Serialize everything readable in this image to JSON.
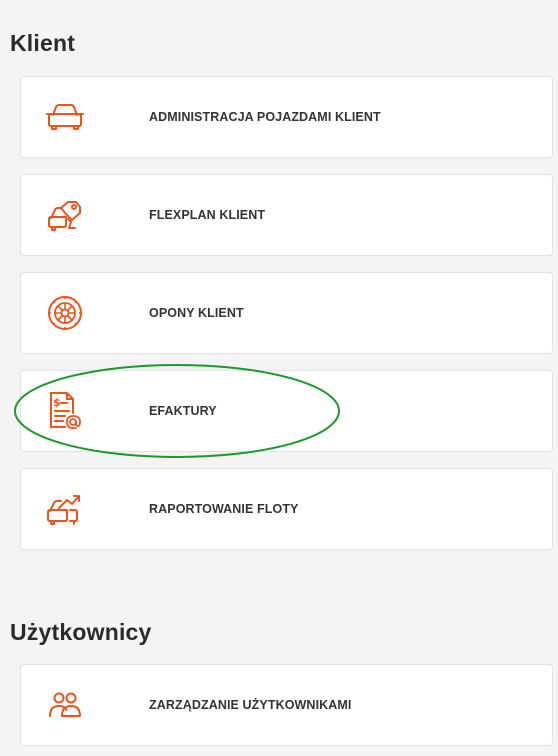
{
  "colors": {
    "accent": "#e8551f",
    "highlight": "#1a9a2a",
    "background": "#f4f4f4",
    "card": "#ffffff",
    "text": "#333333"
  },
  "sections": {
    "client": {
      "title": "Klient",
      "items": [
        {
          "label": "ADMINISTRACJA POJAZDAMI KLIENT",
          "icon": "car-icon"
        },
        {
          "label": "FLEXPLAN KLIENT",
          "icon": "car-key-tag-icon"
        },
        {
          "label": "OPONY KLIENT",
          "icon": "tire-icon"
        },
        {
          "label": "EFAKTURY",
          "icon": "e-invoice-icon"
        },
        {
          "label": "RAPORTOWANIE FLOTY",
          "icon": "fleet-report-icon"
        }
      ]
    },
    "users": {
      "title": "Użytkownicy",
      "items": [
        {
          "label": "ZARZĄDZANIE UŻYTKOWNIKAMI",
          "icon": "users-icon"
        }
      ]
    }
  }
}
